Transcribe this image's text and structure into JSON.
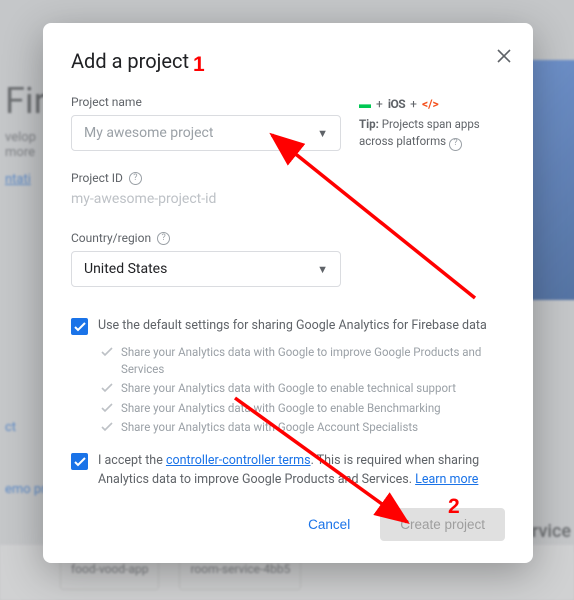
{
  "bg": {
    "title": "Fire",
    "line1": "velop",
    "line2": "more",
    "link_doc": "ntati",
    "link_ct": "ct",
    "link_demo": "emo pro",
    "bottom1": "food-vood-app",
    "bottom2": "room-service-4bb5",
    "rvice": "rvice"
  },
  "dialog": {
    "title": "Add a project",
    "labels": {
      "name": "Project name",
      "id": "Project ID",
      "region": "Country/region"
    },
    "name_placeholder": "My awesome project",
    "id_value": "my-awesome-project-id",
    "region_value": "United States",
    "tip": {
      "prefix": "Tip:",
      "text": "Projects span apps across platforms"
    },
    "check1": "Use the default settings for sharing Google Analytics for Firebase data",
    "subs": [
      "Share your Analytics data with Google to improve Google Products and Services",
      "Share your Analytics data with Google to enable technical support",
      "Share your Analytics data with Google to enable Benchmarking",
      "Share your Analytics data with Google Account Specialists"
    ],
    "check2_pre": "I accept the ",
    "check2_link1": "controller-controller terms",
    "check2_mid": ". This is required when sharing Analytics data to improve Google Products and Services. ",
    "check2_link2": "Learn more",
    "cancel": "Cancel",
    "create": "Create project"
  },
  "anno": {
    "n1": "1",
    "n2": "2"
  },
  "icons": {
    "plus": "+",
    "ios": "iOS",
    "web": "</>"
  }
}
